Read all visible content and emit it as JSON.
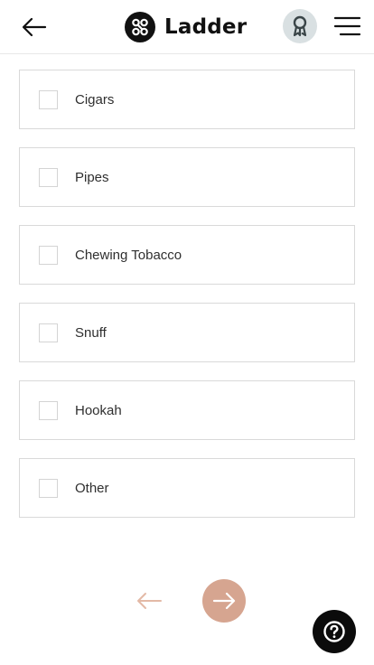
{
  "header": {
    "brand_name": "Ladder",
    "icons": {
      "back": "arrow-left-icon",
      "logo": "ladder-logo-icon",
      "award": "award-ribbon-icon",
      "menu": "hamburger-menu-icon"
    }
  },
  "options": [
    {
      "label": "Cigars",
      "checked": false
    },
    {
      "label": "Pipes",
      "checked": false
    },
    {
      "label": "Chewing Tobacco",
      "checked": false
    },
    {
      "label": "Snuff",
      "checked": false
    },
    {
      "label": "Hookah",
      "checked": false
    },
    {
      "label": "Other",
      "checked": false
    }
  ],
  "navigation": {
    "prev_icon": "arrow-left-icon",
    "next_icon": "arrow-right-icon",
    "help_icon": "question-mark-icon"
  },
  "colors": {
    "accent": "#d6a590",
    "accent_light": "#e3b9a6",
    "award_bg": "#d9e0e2",
    "border": "#d9d9d9",
    "help_bg": "#0b0b0b"
  }
}
